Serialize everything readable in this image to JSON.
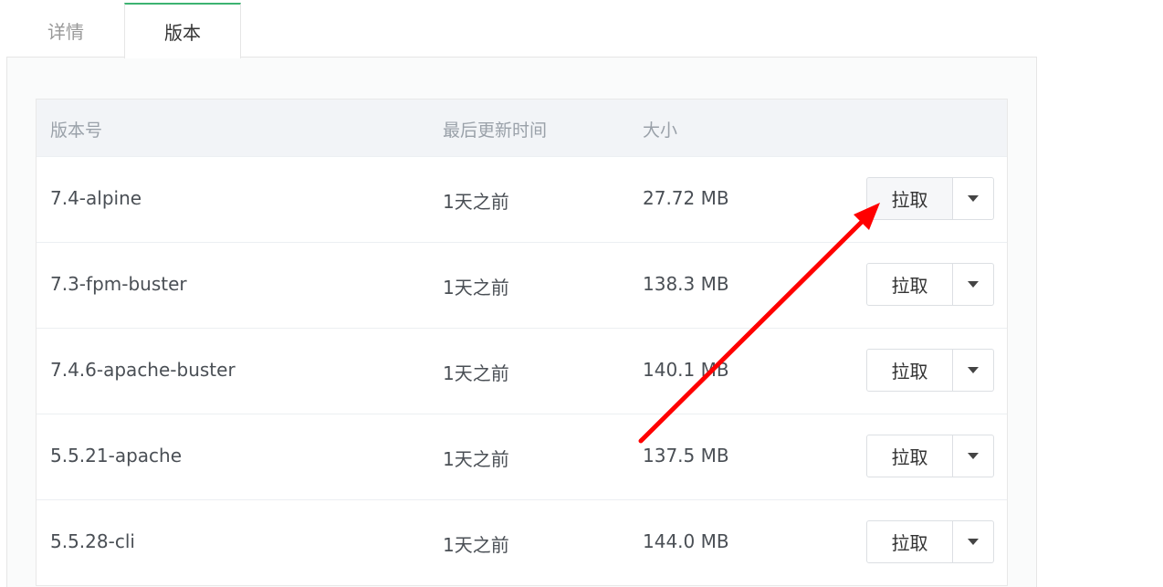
{
  "tabs": [
    {
      "label": "详情",
      "active": false
    },
    {
      "label": "版本",
      "active": true
    }
  ],
  "table": {
    "headers": {
      "version": "版本号",
      "updated": "最后更新时间",
      "size": "大小"
    },
    "rows": [
      {
        "version": "7.4-alpine",
        "updated": "1天之前",
        "size": "27.72 MB",
        "action": "拉取"
      },
      {
        "version": "7.3-fpm-buster",
        "updated": "1天之前",
        "size": "138.3 MB",
        "action": "拉取"
      },
      {
        "version": "7.4.6-apache-buster",
        "updated": "1天之前",
        "size": "140.1 MB",
        "action": "拉取"
      },
      {
        "version": "5.5.21-apache",
        "updated": "1天之前",
        "size": "137.5 MB",
        "action": "拉取"
      },
      {
        "version": "5.5.28-cli",
        "updated": "1天之前",
        "size": "144.0 MB",
        "action": "拉取"
      }
    ]
  },
  "colors": {
    "active_tab_accent": "#3cb371",
    "annotation_arrow": "#ff0000"
  },
  "icons": {
    "dropdown": "caret-down-icon"
  }
}
